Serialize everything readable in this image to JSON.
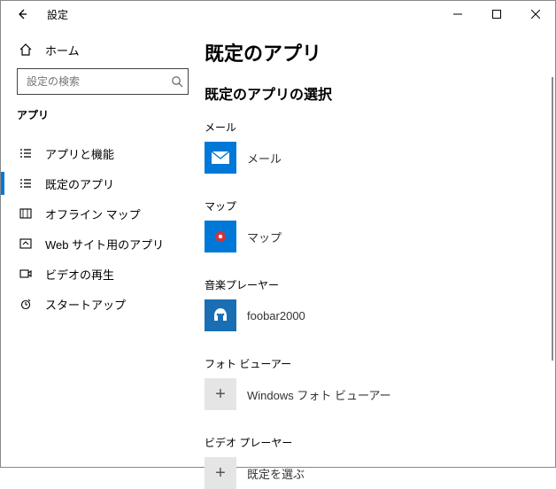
{
  "titlebar": {
    "title": "設定"
  },
  "sidebar": {
    "home": "ホーム",
    "search_placeholder": "設定の検索",
    "section": "アプリ",
    "items": [
      {
        "label": "アプリと機能"
      },
      {
        "label": "既定のアプリ"
      },
      {
        "label": "オフライン マップ"
      },
      {
        "label": "Web サイト用のアプリ"
      },
      {
        "label": "ビデオの再生"
      },
      {
        "label": "スタートアップ"
      }
    ]
  },
  "content": {
    "title": "既定のアプリ",
    "subtitle": "既定のアプリの選択",
    "categories": [
      {
        "label": "メール",
        "app": "メール",
        "tile": "mail"
      },
      {
        "label": "マップ",
        "app": "マップ",
        "tile": "maps"
      },
      {
        "label": "音楽プレーヤー",
        "app": "foobar2000",
        "tile": "foobar"
      },
      {
        "label": "フォト ビューアー",
        "app": "Windows フォト ビューアー",
        "tile": "plus"
      },
      {
        "label": "ビデオ プレーヤー",
        "app": "既定を選ぶ",
        "tile": "plus"
      }
    ]
  }
}
